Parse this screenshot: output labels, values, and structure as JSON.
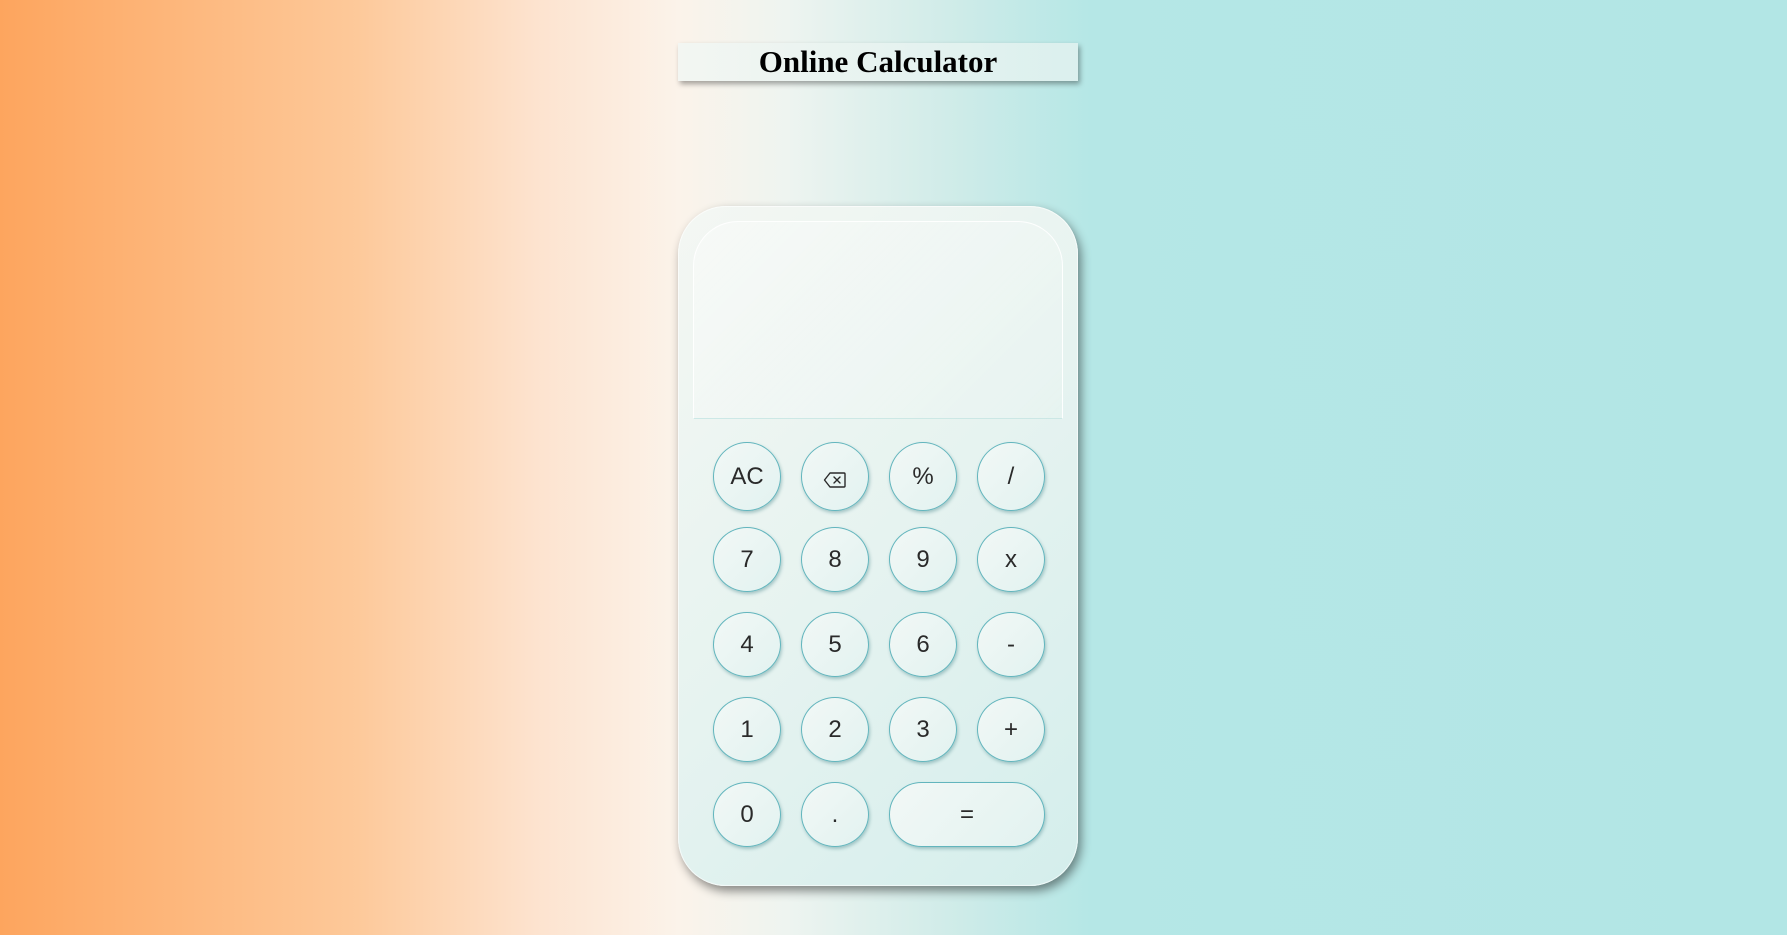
{
  "header": {
    "title": "Online Calculator"
  },
  "display": {
    "value": ""
  },
  "keys": {
    "clear": "AC",
    "backspace_icon": "backspace-icon",
    "percent": "%",
    "divide": "/",
    "seven": "7",
    "eight": "8",
    "nine": "9",
    "multiply": "x",
    "four": "4",
    "five": "5",
    "six": "6",
    "subtract": "-",
    "one": "1",
    "two": "2",
    "three": "3",
    "add": "+",
    "zero": "0",
    "decimal": ".",
    "equals": "="
  },
  "colors": {
    "key_border": "#62b5bd",
    "gradient_left": "#fda55e",
    "gradient_right": "#b2e6e5"
  }
}
